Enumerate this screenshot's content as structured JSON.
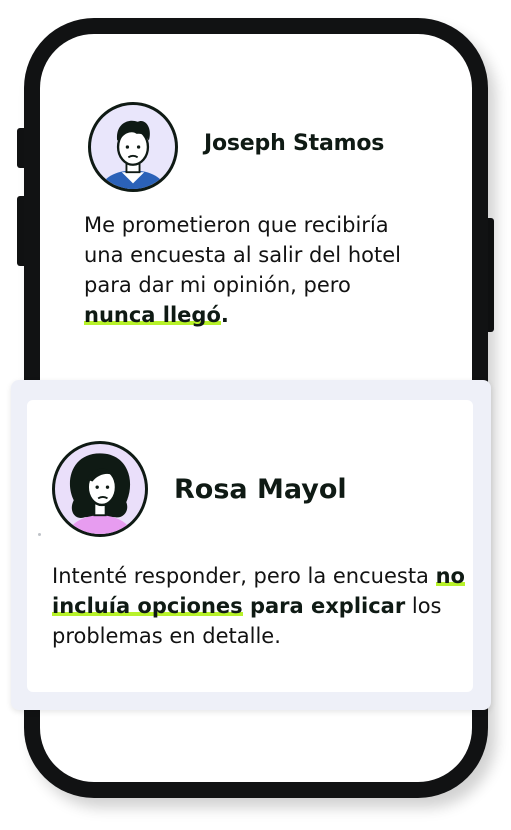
{
  "message_1": {
    "author": "Joseph Stamos",
    "text_before": "Me prometieron que recibiría una encuesta al salir del hotel para dar mi opinión, pero ",
    "highlight": "nunca llegó",
    "text_after": "."
  },
  "message_2": {
    "author": "Rosa Mayol",
    "text_before": "Intenté responder, pero la encuesta ",
    "highlight": "no incluía opciones",
    "bold": " para explicar",
    "text_after": " los problemas en detalle."
  },
  "colors": {
    "highlight_underline": "#b7f22a",
    "phone_body": "#111213",
    "card_background": "#eef0f8",
    "avatar_1_background": "#e9e6fb",
    "avatar_2_background": "#eadffa"
  },
  "icons": {
    "avatar_1": "man-avatar-icon",
    "avatar_2": "woman-avatar-icon"
  }
}
